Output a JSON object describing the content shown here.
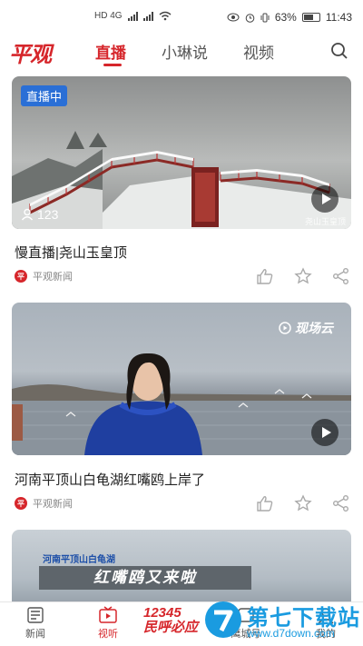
{
  "status_bar": {
    "network_left": "HD 4G",
    "battery_percent": "63%",
    "time": "11:43"
  },
  "brand": {
    "logo_text": "平观"
  },
  "tabs": [
    {
      "label": "直播",
      "active": true
    },
    {
      "label": "小琳说",
      "active": false
    },
    {
      "label": "视频",
      "active": false
    }
  ],
  "feed": [
    {
      "badge": "直播中",
      "viewers": "123",
      "title": "慢直播|尧山玉皇顶",
      "source": "平观新闻",
      "overlay_tag": "尧山玉皇顶"
    },
    {
      "badge": "",
      "overlay_tag": "现场云",
      "title": "河南平顶山白龟湖红嘴鸥上岸了",
      "source": "平观新闻"
    },
    {
      "overlay_tag": "河南平顶山白龟湖",
      "subtitle": "红嘴鸥又来啦"
    }
  ],
  "bottom_nav": [
    {
      "label": "新闻",
      "active": false
    },
    {
      "label": "视听",
      "active": true
    },
    {
      "label": "鹰城号",
      "active": false
    },
    {
      "label": "我的",
      "active": false
    }
  ],
  "promo": {
    "line1": "12345",
    "line2": "民呼必应"
  },
  "watermark": {
    "title": "第七下载站",
    "url": "www.d7down.com"
  },
  "colors": {
    "brand_red": "#d6262b",
    "live_blue": "#2a6fd6"
  }
}
